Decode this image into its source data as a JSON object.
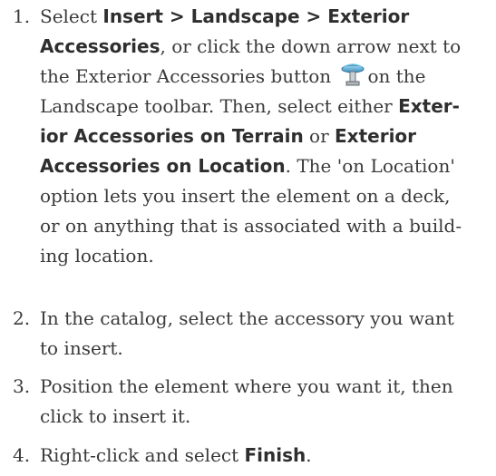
{
  "steps": [
    {
      "number": "1.",
      "lines": [
        [
          {
            "t": "Select ",
            "b": false
          },
          {
            "t": "Insert > Landscape > Exterior",
            "b": true
          }
        ],
        [
          {
            "t": "Accessories",
            "b": true
          },
          {
            "t": ", or click the down arrow next to",
            "b": false
          }
        ],
        [
          {
            "t": "the Exterior Accessories button ",
            "b": false
          },
          {
            "icon": "exterior-accessories-icon"
          },
          {
            "t": "on the",
            "b": false
          }
        ],
        [
          {
            "t": "Landscape toolbar. Then, select either ",
            "b": false
          },
          {
            "t": "Exter-",
            "b": true
          }
        ],
        [
          {
            "t": "ior Accessories on Terrain",
            "b": true
          },
          {
            "t": " or ",
            "b": false
          },
          {
            "t": "Exterior",
            "b": true
          }
        ],
        [
          {
            "t": "Accessories on Location",
            "b": true
          },
          {
            "t": ". The 'on Location'",
            "b": false
          }
        ],
        [
          {
            "t": "option lets you insert the element on a deck,",
            "b": false
          }
        ],
        [
          {
            "t": "or on anything that is associated with a build-",
            "b": false
          }
        ],
        [
          {
            "t": "ing location.",
            "b": false
          }
        ]
      ]
    },
    {
      "number": "2.",
      "lines": [
        [
          {
            "t": "In the catalog, select the accessory you want",
            "b": false
          }
        ],
        [
          {
            "t": "to insert.",
            "b": false
          }
        ]
      ]
    },
    {
      "number": "3.",
      "lines": [
        [
          {
            "t": "Position the element where you want it, then",
            "b": false
          }
        ],
        [
          {
            "t": "click to insert it.",
            "b": false
          }
        ]
      ]
    },
    {
      "number": "4.",
      "lines": [
        [
          {
            "t": "Right-click and select ",
            "b": false
          },
          {
            "t": "Finish",
            "b": true
          },
          {
            "t": ".",
            "b": false
          }
        ]
      ]
    }
  ]
}
